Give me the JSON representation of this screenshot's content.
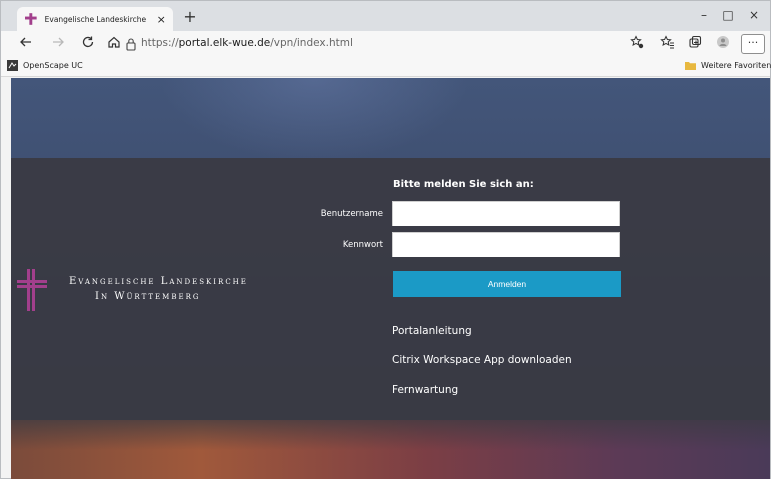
{
  "browser": {
    "tab_title": "Evangelische Landeskirche in Wü",
    "tab_close": "×",
    "new_tab": "+",
    "window_controls": {
      "minimize": "–",
      "maximize": "□",
      "close": "×"
    },
    "url_scheme": "https://",
    "url_host": "portal.elk-wue.de",
    "url_path": "/vpn/index.html",
    "more_label": "···",
    "favorites": [
      {
        "label": "OpenScape UC",
        "icon": "openscape-icon"
      },
      {
        "label": "Weitere Favoriten",
        "icon": "folder-icon"
      }
    ]
  },
  "page": {
    "heading": "Bitte melden Sie sich an:",
    "username_label": "Benutzername",
    "password_label": "Kennwort",
    "username_value": "",
    "password_value": "",
    "login_button": "Anmelden",
    "links": [
      "Portalanleitung",
      "Citrix Workspace App downloaden",
      "Fernwartung"
    ],
    "org_line1": "Evangelische Landeskirche",
    "org_line2": "In Württemberg",
    "colors": {
      "accent": "#1b9ac6",
      "logo": "#a23f8c"
    }
  }
}
